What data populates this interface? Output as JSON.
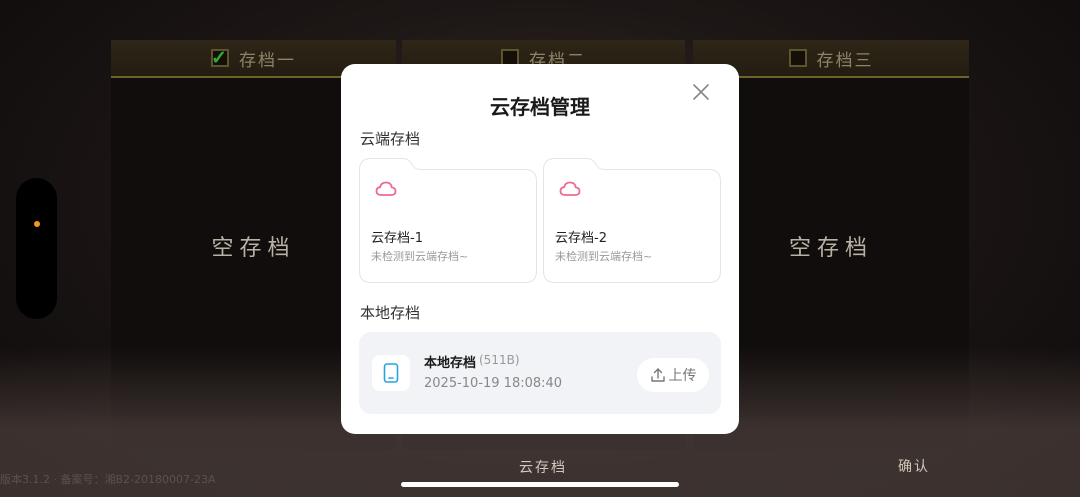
{
  "background": {
    "slots": [
      {
        "label": "存档一",
        "checked": true,
        "empty_text": ""
      },
      {
        "label": "存档二",
        "checked": false,
        "empty_text": ""
      },
      {
        "label": "存档三",
        "checked": false,
        "empty_text": "空存档"
      }
    ],
    "slot1_empty_text": "空存档",
    "footer_text": "版本3.1.2 · 备案号：湘B2-20180007-23A",
    "cloud_button": "云存档",
    "confirm_button": "确认"
  },
  "modal": {
    "title": "云存档管理",
    "cloud_section_label": "云端存档",
    "cloud_saves": [
      {
        "name": "云存档-1",
        "status": "未检测到云端存档~"
      },
      {
        "name": "云存档-2",
        "status": "未检测到云端存档~"
      }
    ],
    "local_section_label": "本地存档",
    "local_save": {
      "name": "本地存档",
      "size": "(511B)",
      "date": "2025-10-19 18:08:40",
      "upload_label": "上传"
    }
  },
  "colors": {
    "accent_pink": "#f06a8f",
    "accent_blue": "#27a3e0",
    "check_green": "#2fae2f"
  },
  "icons": [
    "check-icon",
    "close-icon",
    "cloud-icon",
    "phone-icon",
    "upload-icon"
  ]
}
